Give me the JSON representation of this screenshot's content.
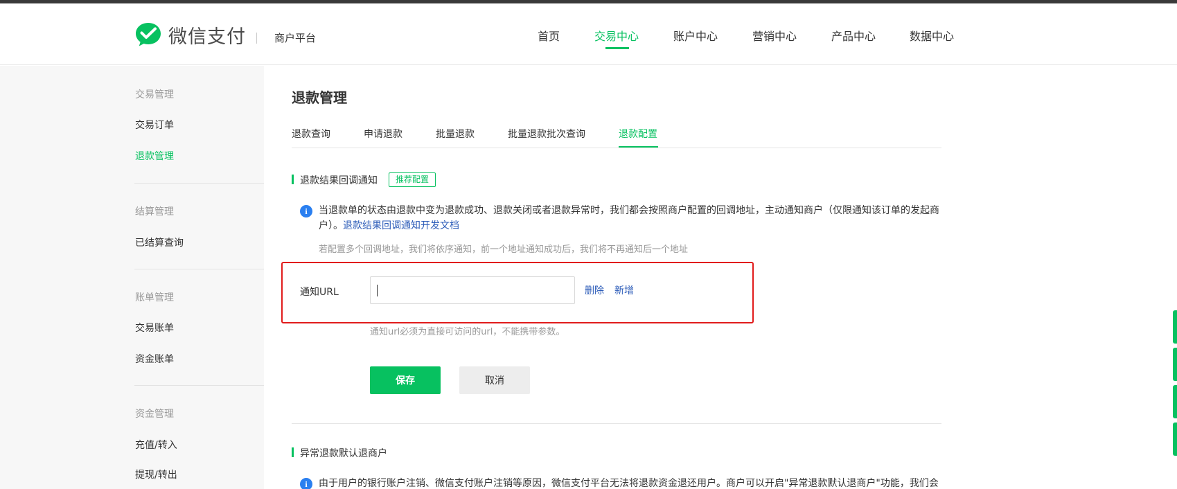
{
  "brand": {
    "logo_text": "微信支付",
    "platform": "商户平台"
  },
  "topnav": {
    "items": [
      {
        "label": "首页",
        "active": false
      },
      {
        "label": "交易中心",
        "active": true
      },
      {
        "label": "账户中心",
        "active": false
      },
      {
        "label": "营销中心",
        "active": false
      },
      {
        "label": "产品中心",
        "active": false
      },
      {
        "label": "数据中心",
        "active": false
      }
    ]
  },
  "sidebar": {
    "groups": [
      {
        "title": "交易管理",
        "items": [
          "交易订单",
          "退款管理"
        ]
      },
      {
        "title": "结算管理",
        "items": [
          "已结算查询"
        ]
      },
      {
        "title": "账单管理",
        "items": [
          "交易账单",
          "资金账单"
        ]
      },
      {
        "title": "资金管理",
        "items": [
          "充值/转入",
          "提现/转出"
        ]
      }
    ],
    "active_item": "退款管理"
  },
  "main": {
    "title": "退款管理",
    "tabs": [
      "退款查询",
      "申请退款",
      "批量退款",
      "批量退款批次查询",
      "退款配置"
    ],
    "active_tab": "退款配置",
    "section1": {
      "title": "退款结果回调通知",
      "badge": "推荐配置",
      "info_text": "当退款单的状态由退款中变为退款成功、退款关闭或者退款异常时，我们都会按照商户配置的回调地址，主动通知商户（仅限通知该订单的发起商户）。",
      "info_link": "退款结果回调通知开发文档",
      "info_sub": "若配置多个回调地址，我们将依序通知，前一个地址通知成功后，我们将不再通知后一个地址",
      "field_label": "通知URL",
      "url_value": "",
      "delete_label": "删除",
      "add_label": "新增",
      "hint": "通知url必须为直接可访问的url，不能携带参数。",
      "save_label": "保存",
      "cancel_label": "取消"
    },
    "section2": {
      "title": "异常退款默认退商户",
      "info_text": "由于用户的银行账户注销、微信支付账户注销等原因，微信支付平台无法将退款资金退还用户。商户可以开启\"异常退款默认退商户\"功能，我们会将"
    }
  },
  "colors": {
    "brand_green": "#07c160",
    "link_blue": "#2b5bb8",
    "highlight_red": "#e11b1b",
    "info_blue": "#2a7ff0"
  }
}
